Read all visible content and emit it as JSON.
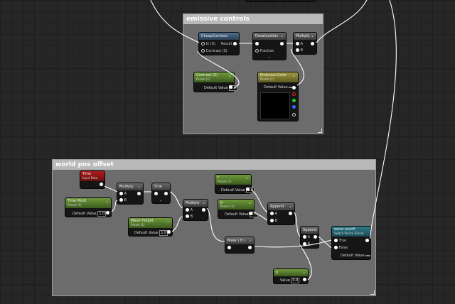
{
  "colors": {
    "grid": "#262626",
    "comment_body": "#6c6c6c",
    "comment_header": "#b9b9b9",
    "wire": "#ffffff",
    "param_green": "#6f9a3a",
    "function_blue": "#4d6f8e",
    "time_red": "#b01c1c",
    "vector_olive": "#9f9a3d",
    "switch_teal": "#2f7a88"
  },
  "emissive": {
    "title": "emissive controls",
    "cheap_contrast": {
      "title": "CheapContrast",
      "in": "In (S)",
      "result": "Result",
      "contrast": "Contrast (S)"
    },
    "desaturation": {
      "title": "Desaturation",
      "fraction": "Fraction"
    },
    "multiply": {
      "title": "Multiply",
      "a": "A",
      "b": "B"
    },
    "contrast_param": {
      "title": "Contrast (S)",
      "subtitle": "Param (1)",
      "label": "Default Value",
      "value": "0.0"
    },
    "emissive_color": {
      "title": "Emissive Color",
      "subtitle": "Param (1)",
      "label": "Default Value"
    }
  },
  "worldpos": {
    "title": "world pos offset",
    "time": {
      "title": "Time",
      "subtitle": "Input Data"
    },
    "multiply1": {
      "title": "Multiply",
      "a": "A",
      "b": "B"
    },
    "time_mult": {
      "title": "Time Multi",
      "subtitle": "Param (1)",
      "label": "Default Value",
      "value": "1.0"
    },
    "sine": {
      "title": "Sine"
    },
    "multiply2": {
      "title": "Multiply",
      "a": "A",
      "b": "B"
    },
    "wave_height": {
      "title": "Wave Height",
      "subtitle": "Param (1)",
      "label": "Default Value",
      "value": "1.0"
    },
    "param_r": {
      "title": "r",
      "subtitle": "Param (1)",
      "label": "Default Value",
      "value": "0.0"
    },
    "param_g": {
      "title": "g",
      "subtitle": "Param (1)",
      "label": "Default Value",
      "value": "0.0"
    },
    "append1": {
      "title": "Append",
      "a": "A",
      "b": "B"
    },
    "append2": {
      "title": "Append",
      "a": "A",
      "b": "B"
    },
    "mask": {
      "title": "Mask ( B )"
    },
    "switch": {
      "title": "wave on/off",
      "subtitle": "Switch Param (False)",
      "true": "True",
      "false": "False",
      "label": "Default Value"
    },
    "const_b": {
      "title": "b",
      "label": "Value",
      "value": "0.0"
    }
  }
}
